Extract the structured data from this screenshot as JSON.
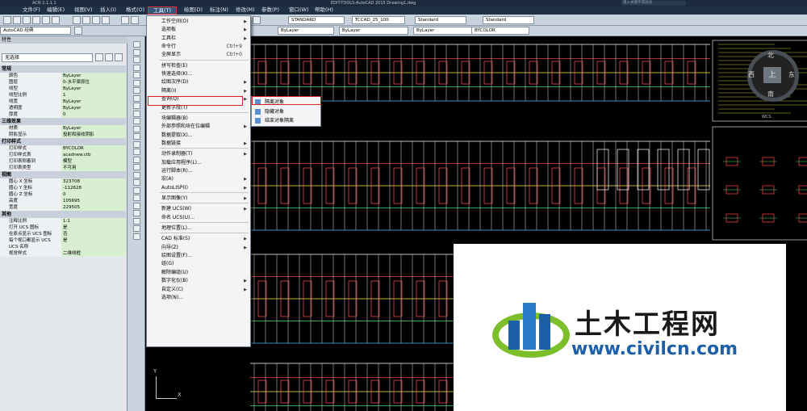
{
  "titlebar": {
    "left_text": "ACN 2.1.1.1",
    "center_text": "EDIT-TOOLS-AutoCAD 2015   Drawing1.dwg",
    "search_placeholder": "键入关键字或短语"
  },
  "menubar": [
    {
      "label": "文件(F)"
    },
    {
      "label": "编辑(E)"
    },
    {
      "label": "视图(V)"
    },
    {
      "label": "插入(I)"
    },
    {
      "label": "格式(O)"
    },
    {
      "label": "工具(T)",
      "selected": true
    },
    {
      "label": "绘图(D)"
    },
    {
      "label": "标注(N)"
    },
    {
      "label": "修改(M)"
    },
    {
      "label": "参数(P)"
    },
    {
      "label": "窗口(W)"
    },
    {
      "label": "帮助(H)"
    }
  ],
  "toolbar": {
    "style_combo": "STANDARD",
    "dim_combo": "TCCAD_25_100",
    "table_combo": "Standard",
    "mleader_combo": "Standard",
    "workspace_combo": "AutoCAD 经典",
    "layer_combo": "ByLayer",
    "linetype_combo": "ByLayer",
    "lineweight_combo": "ByLayer",
    "color_combo": "BYCOLOR"
  },
  "palette": {
    "title": "特性",
    "selection": "无选择",
    "sections": [
      {
        "name": "常规",
        "rows": [
          [
            "颜色",
            "ByLayer"
          ],
          [
            "图层",
            "0-水平梁原位"
          ],
          [
            "线型",
            "ByLayer"
          ],
          [
            "线型比例",
            "1"
          ],
          [
            "线宽",
            "ByLayer"
          ],
          [
            "透明度",
            "ByLayer"
          ],
          [
            "厚度",
            "0"
          ]
        ]
      },
      {
        "name": "三维效果",
        "rows": [
          [
            "材质",
            "ByLayer"
          ],
          [
            "阴影显示",
            "投射和接收阴影"
          ]
        ]
      },
      {
        "name": "打印样式",
        "rows": [
          [
            "打印样式",
            "BYCOLOR"
          ],
          [
            "打印样式表",
            "acadnew.ctb"
          ],
          [
            "打印表附着到",
            "模型"
          ],
          [
            "打印表类型",
            "不可用"
          ]
        ]
      },
      {
        "name": "视图",
        "rows": [
          [
            "圆心 X 坐标",
            "323708"
          ],
          [
            "圆心 Y 坐标",
            "-112628"
          ],
          [
            "圆心 Z 坐标",
            "0"
          ],
          [
            "高度",
            "105695"
          ],
          [
            "宽度",
            "229505"
          ]
        ]
      },
      {
        "name": "其他",
        "rows": [
          [
            "注释比例",
            "1:1"
          ],
          [
            "打开 UCS 图标",
            "是"
          ],
          [
            "在原点显示 UCS 图标",
            "否"
          ],
          [
            "每个视口都显示 UCS",
            "是"
          ],
          [
            "UCS 名称",
            ""
          ],
          [
            "视觉样式",
            "二维线框"
          ]
        ]
      }
    ]
  },
  "tools_menu": {
    "items": [
      {
        "label": "工作空间(O)",
        "arrow": true
      },
      {
        "label": "选项板",
        "arrow": true
      },
      {
        "label": "工具栏",
        "arrow": true
      },
      {
        "label": "命令行",
        "shortcut": "Ctrl+9"
      },
      {
        "label": "全屏显示",
        "shortcut": "Ctrl+0"
      },
      {
        "sep": true
      },
      {
        "label": "拼写检查(E)"
      },
      {
        "label": "快速选择(K)..."
      },
      {
        "label": "绘图次序(D)",
        "arrow": true
      },
      {
        "label": "隔离(I)",
        "arrow": true,
        "highlight": true
      },
      {
        "label": "查询(Q)",
        "arrow": true
      },
      {
        "label": "更新字段(T)"
      },
      {
        "sep": true
      },
      {
        "label": "块编辑器(B)"
      },
      {
        "label": "外部参照和块在位编辑",
        "arrow": true
      },
      {
        "label": "数据提取(X)..."
      },
      {
        "label": "数据链接",
        "arrow": true
      },
      {
        "sep": true
      },
      {
        "label": "动作录制器(T)",
        "arrow": true
      },
      {
        "label": "加载应用程序(L)..."
      },
      {
        "label": "运行脚本(R)..."
      },
      {
        "label": "宏(A)",
        "arrow": true
      },
      {
        "label": "AutoLISP(I)",
        "arrow": true
      },
      {
        "sep": true
      },
      {
        "label": "显示图像(Y)",
        "arrow": true
      },
      {
        "sep": true
      },
      {
        "label": "新建 UCS(W)",
        "arrow": true
      },
      {
        "label": "命名 UCS(U)..."
      },
      {
        "sep": true
      },
      {
        "label": "地理位置(L)..."
      },
      {
        "sep": true
      },
      {
        "label": "CAD 标准(S)",
        "arrow": true
      },
      {
        "label": "向导(Z)",
        "arrow": true
      },
      {
        "label": "绘图设置(F)..."
      },
      {
        "label": "组(G)"
      },
      {
        "label": "解除编组(U)"
      },
      {
        "label": "数字化仪(B)",
        "arrow": true
      },
      {
        "label": "自定义(C)",
        "arrow": true
      },
      {
        "label": "选项(N)..."
      }
    ]
  },
  "isolate_submenu": {
    "items": [
      {
        "label": "隔离对象",
        "highlight": true
      },
      {
        "label": "隐藏对象"
      },
      {
        "label": "结束对象隔离"
      }
    ]
  },
  "viewcube": {
    "north": "北",
    "south": "南",
    "east": "东",
    "west": "西",
    "top": "上",
    "wcs": "WCS"
  },
  "ucs": {
    "y": "Y",
    "x": "X"
  },
  "watermark": {
    "cn": "土木工程网",
    "url": "www.civilcn.com"
  },
  "colors": {
    "accent_red": "#d92020",
    "cad_bg": "#000000",
    "palette_value_green": "#d7efd0"
  }
}
